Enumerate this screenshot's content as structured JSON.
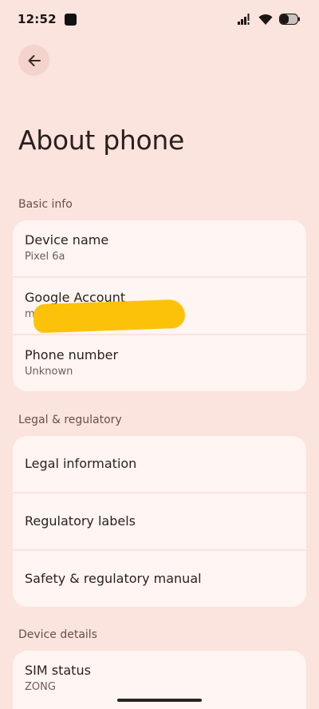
{
  "status_bar": {
    "time": "12:52",
    "icons": [
      "notification-square-icon",
      "signal-icon",
      "wifi-icon",
      "battery-icon"
    ]
  },
  "header": {
    "back_icon": "arrow-back-icon",
    "title": "About phone"
  },
  "sections": {
    "basic_info": {
      "label": "Basic info",
      "rows": [
        {
          "title": "Device name",
          "subtitle": "Pixel 6a"
        },
        {
          "title": "Google Account",
          "subtitle": "ms                              .com"
        },
        {
          "title": "Phone number",
          "subtitle": "Unknown"
        }
      ]
    },
    "legal": {
      "label": "Legal & regulatory",
      "rows": [
        {
          "title": "Legal information"
        },
        {
          "title": "Regulatory labels"
        },
        {
          "title": "Safety & regulatory manual"
        }
      ]
    },
    "device_details": {
      "label": "Device details",
      "rows": [
        {
          "title": "SIM status",
          "subtitle": "ZONG"
        }
      ]
    }
  },
  "colors": {
    "background": "#fbe3de",
    "card": "#fff5f2",
    "redaction": "#fcc20a"
  }
}
